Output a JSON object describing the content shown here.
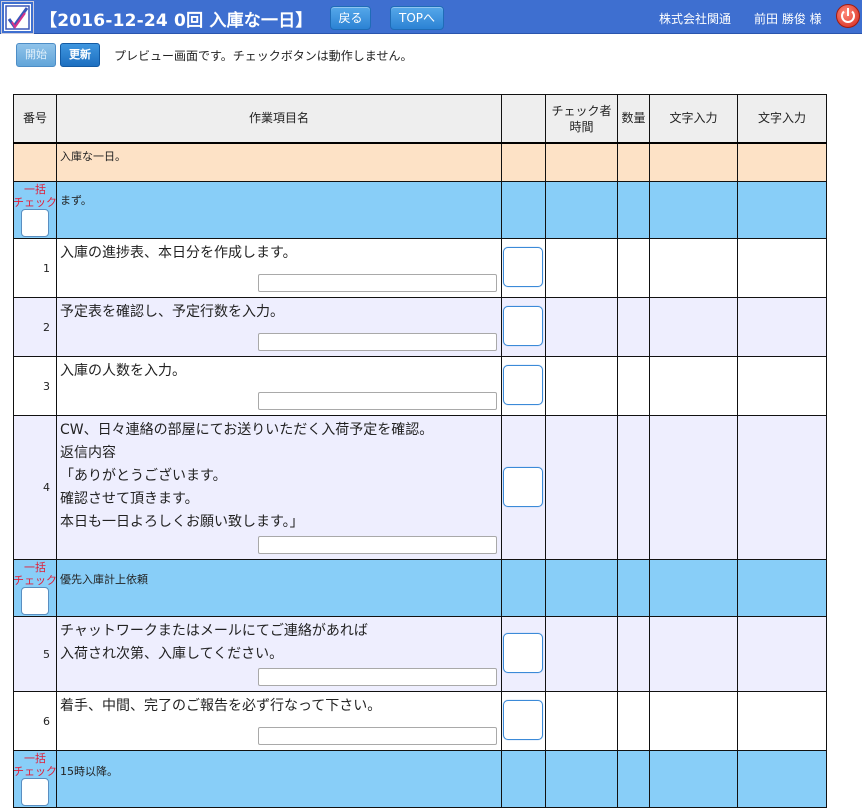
{
  "header": {
    "title": "【2016-12-24 0回 入庫な一日】",
    "back_label": "戻る",
    "top_label": "TOPへ",
    "company": "株式会社関通",
    "user": "前田 勝俊 様",
    "logo_icon": "checkmark-logo-icon",
    "logout_icon": "power-icon"
  },
  "toolbar": {
    "start_label": "開始",
    "update_label": "更新",
    "notice": "プレビュー画面です。チェックボタンは動作しません。"
  },
  "table": {
    "columns": {
      "num": "番号",
      "name": "作業項目名",
      "check": "",
      "checker_line1": "チェック者",
      "checker_line2": "時間",
      "qty": "数量",
      "text1": "文字入力",
      "text2": "文字入力"
    },
    "bulk_label_line1": "一括",
    "bulk_label_line2": "チェック",
    "title_row": "入庫な一日。",
    "sections": [
      {
        "label": "まず。",
        "items": [
          {
            "num": "1",
            "lines": [
              "入庫の進捗表、本日分を作成します。"
            ]
          },
          {
            "num": "2",
            "lines": [
              "予定表を確認し、予定行数を入力。"
            ]
          },
          {
            "num": "3",
            "lines": [
              "入庫の人数を入力。"
            ]
          },
          {
            "num": "4",
            "lines": [
              "CW、日々連絡の部屋にてお送りいただく入荷予定を確認。",
              "返信内容",
              "「ありがとうございます。",
              "確認させて頂きます。",
              "本日も一日よろしくお願い致します。」"
            ]
          }
        ]
      },
      {
        "label": "優先入庫計上依頼",
        "items": [
          {
            "num": "5",
            "lines": [
              "チャットワークまたはメールにてご連絡があれば",
              "入荷され次第、入庫してください。"
            ]
          },
          {
            "num": "6",
            "lines": [
              "着手、中間、完了のご報告を必ず行なって下さい。"
            ]
          }
        ]
      },
      {
        "label": "15時以降。",
        "items": []
      }
    ]
  },
  "colors": {
    "header_bg": "#3e6fd0",
    "section_bg": "#88cef8",
    "title_row_bg": "#fde2c6",
    "even_row_bg": "#eeeefe",
    "bulk_label": "#e0203a"
  }
}
